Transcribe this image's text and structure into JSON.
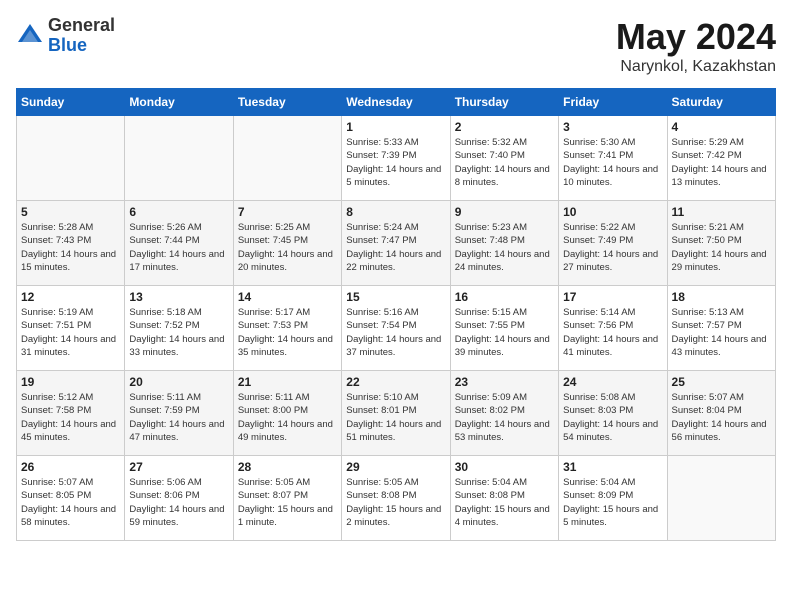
{
  "header": {
    "logo_general": "General",
    "logo_blue": "Blue",
    "title": "May 2024",
    "location": "Narynkol, Kazakhstan"
  },
  "weekdays": [
    "Sunday",
    "Monday",
    "Tuesday",
    "Wednesday",
    "Thursday",
    "Friday",
    "Saturday"
  ],
  "weeks": [
    [
      {
        "day": "",
        "sunrise": "",
        "sunset": "",
        "daylight": ""
      },
      {
        "day": "",
        "sunrise": "",
        "sunset": "",
        "daylight": ""
      },
      {
        "day": "",
        "sunrise": "",
        "sunset": "",
        "daylight": ""
      },
      {
        "day": "1",
        "sunrise": "Sunrise: 5:33 AM",
        "sunset": "Sunset: 7:39 PM",
        "daylight": "Daylight: 14 hours and 5 minutes."
      },
      {
        "day": "2",
        "sunrise": "Sunrise: 5:32 AM",
        "sunset": "Sunset: 7:40 PM",
        "daylight": "Daylight: 14 hours and 8 minutes."
      },
      {
        "day": "3",
        "sunrise": "Sunrise: 5:30 AM",
        "sunset": "Sunset: 7:41 PM",
        "daylight": "Daylight: 14 hours and 10 minutes."
      },
      {
        "day": "4",
        "sunrise": "Sunrise: 5:29 AM",
        "sunset": "Sunset: 7:42 PM",
        "daylight": "Daylight: 14 hours and 13 minutes."
      }
    ],
    [
      {
        "day": "5",
        "sunrise": "Sunrise: 5:28 AM",
        "sunset": "Sunset: 7:43 PM",
        "daylight": "Daylight: 14 hours and 15 minutes."
      },
      {
        "day": "6",
        "sunrise": "Sunrise: 5:26 AM",
        "sunset": "Sunset: 7:44 PM",
        "daylight": "Daylight: 14 hours and 17 minutes."
      },
      {
        "day": "7",
        "sunrise": "Sunrise: 5:25 AM",
        "sunset": "Sunset: 7:45 PM",
        "daylight": "Daylight: 14 hours and 20 minutes."
      },
      {
        "day": "8",
        "sunrise": "Sunrise: 5:24 AM",
        "sunset": "Sunset: 7:47 PM",
        "daylight": "Daylight: 14 hours and 22 minutes."
      },
      {
        "day": "9",
        "sunrise": "Sunrise: 5:23 AM",
        "sunset": "Sunset: 7:48 PM",
        "daylight": "Daylight: 14 hours and 24 minutes."
      },
      {
        "day": "10",
        "sunrise": "Sunrise: 5:22 AM",
        "sunset": "Sunset: 7:49 PM",
        "daylight": "Daylight: 14 hours and 27 minutes."
      },
      {
        "day": "11",
        "sunrise": "Sunrise: 5:21 AM",
        "sunset": "Sunset: 7:50 PM",
        "daylight": "Daylight: 14 hours and 29 minutes."
      }
    ],
    [
      {
        "day": "12",
        "sunrise": "Sunrise: 5:19 AM",
        "sunset": "Sunset: 7:51 PM",
        "daylight": "Daylight: 14 hours and 31 minutes."
      },
      {
        "day": "13",
        "sunrise": "Sunrise: 5:18 AM",
        "sunset": "Sunset: 7:52 PM",
        "daylight": "Daylight: 14 hours and 33 minutes."
      },
      {
        "day": "14",
        "sunrise": "Sunrise: 5:17 AM",
        "sunset": "Sunset: 7:53 PM",
        "daylight": "Daylight: 14 hours and 35 minutes."
      },
      {
        "day": "15",
        "sunrise": "Sunrise: 5:16 AM",
        "sunset": "Sunset: 7:54 PM",
        "daylight": "Daylight: 14 hours and 37 minutes."
      },
      {
        "day": "16",
        "sunrise": "Sunrise: 5:15 AM",
        "sunset": "Sunset: 7:55 PM",
        "daylight": "Daylight: 14 hours and 39 minutes."
      },
      {
        "day": "17",
        "sunrise": "Sunrise: 5:14 AM",
        "sunset": "Sunset: 7:56 PM",
        "daylight": "Daylight: 14 hours and 41 minutes."
      },
      {
        "day": "18",
        "sunrise": "Sunrise: 5:13 AM",
        "sunset": "Sunset: 7:57 PM",
        "daylight": "Daylight: 14 hours and 43 minutes."
      }
    ],
    [
      {
        "day": "19",
        "sunrise": "Sunrise: 5:12 AM",
        "sunset": "Sunset: 7:58 PM",
        "daylight": "Daylight: 14 hours and 45 minutes."
      },
      {
        "day": "20",
        "sunrise": "Sunrise: 5:11 AM",
        "sunset": "Sunset: 7:59 PM",
        "daylight": "Daylight: 14 hours and 47 minutes."
      },
      {
        "day": "21",
        "sunrise": "Sunrise: 5:11 AM",
        "sunset": "Sunset: 8:00 PM",
        "daylight": "Daylight: 14 hours and 49 minutes."
      },
      {
        "day": "22",
        "sunrise": "Sunrise: 5:10 AM",
        "sunset": "Sunset: 8:01 PM",
        "daylight": "Daylight: 14 hours and 51 minutes."
      },
      {
        "day": "23",
        "sunrise": "Sunrise: 5:09 AM",
        "sunset": "Sunset: 8:02 PM",
        "daylight": "Daylight: 14 hours and 53 minutes."
      },
      {
        "day": "24",
        "sunrise": "Sunrise: 5:08 AM",
        "sunset": "Sunset: 8:03 PM",
        "daylight": "Daylight: 14 hours and 54 minutes."
      },
      {
        "day": "25",
        "sunrise": "Sunrise: 5:07 AM",
        "sunset": "Sunset: 8:04 PM",
        "daylight": "Daylight: 14 hours and 56 minutes."
      }
    ],
    [
      {
        "day": "26",
        "sunrise": "Sunrise: 5:07 AM",
        "sunset": "Sunset: 8:05 PM",
        "daylight": "Daylight: 14 hours and 58 minutes."
      },
      {
        "day": "27",
        "sunrise": "Sunrise: 5:06 AM",
        "sunset": "Sunset: 8:06 PM",
        "daylight": "Daylight: 14 hours and 59 minutes."
      },
      {
        "day": "28",
        "sunrise": "Sunrise: 5:05 AM",
        "sunset": "Sunset: 8:07 PM",
        "daylight": "Daylight: 15 hours and 1 minute."
      },
      {
        "day": "29",
        "sunrise": "Sunrise: 5:05 AM",
        "sunset": "Sunset: 8:08 PM",
        "daylight": "Daylight: 15 hours and 2 minutes."
      },
      {
        "day": "30",
        "sunrise": "Sunrise: 5:04 AM",
        "sunset": "Sunset: 8:08 PM",
        "daylight": "Daylight: 15 hours and 4 minutes."
      },
      {
        "day": "31",
        "sunrise": "Sunrise: 5:04 AM",
        "sunset": "Sunset: 8:09 PM",
        "daylight": "Daylight: 15 hours and 5 minutes."
      },
      {
        "day": "",
        "sunrise": "",
        "sunset": "",
        "daylight": ""
      }
    ]
  ]
}
